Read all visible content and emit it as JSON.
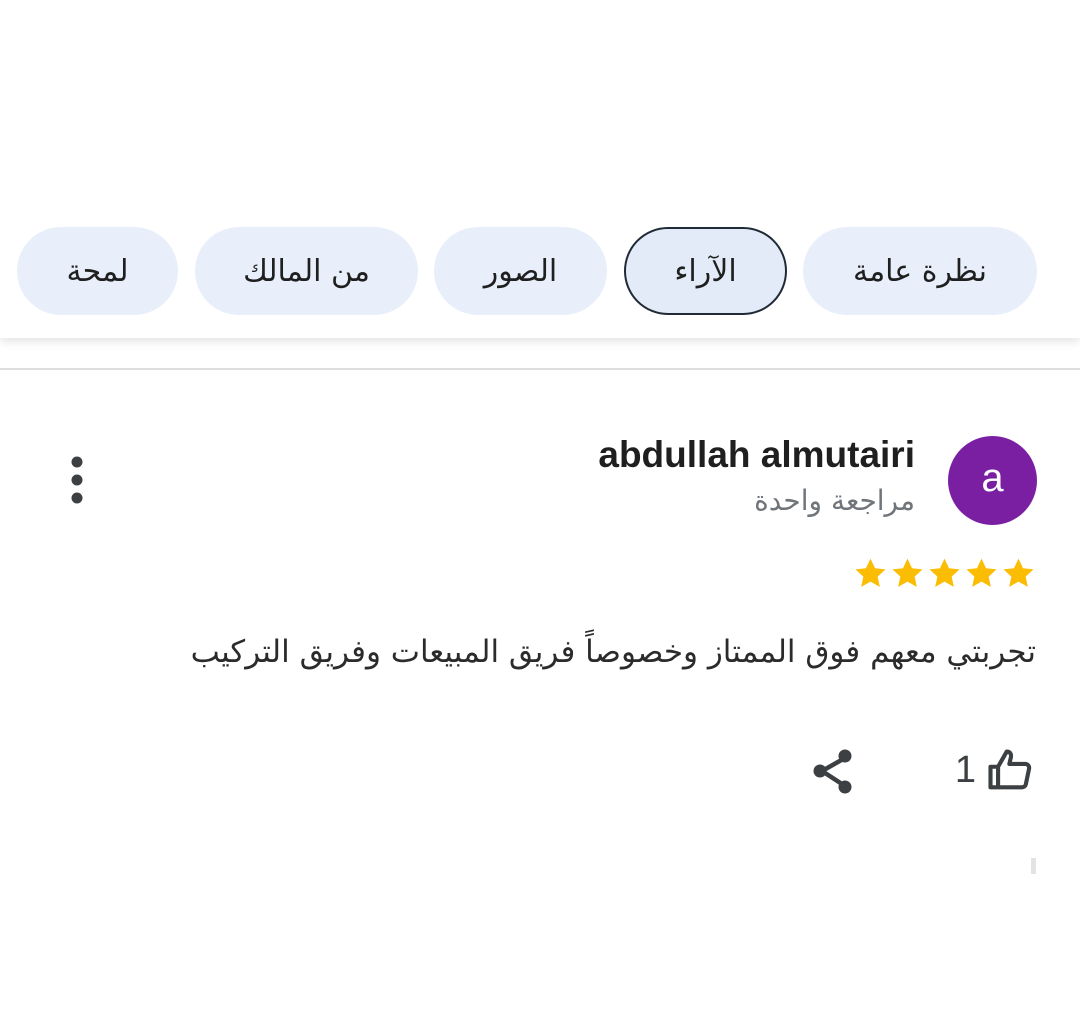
{
  "tabs": [
    {
      "label": "نظرة عامة",
      "selected": false
    },
    {
      "label": "الآراء",
      "selected": true
    },
    {
      "label": "الصور",
      "selected": false
    },
    {
      "label": "من المالك",
      "selected": false
    },
    {
      "label": "لمحة",
      "selected": false
    }
  ],
  "review": {
    "avatar_letter": "a",
    "avatar_color": "#7b1fa2",
    "author": "abdullah almutairi",
    "review_count": "مراجعة واحدة",
    "rating": 5,
    "text": "تجربتي معهم فوق الممتاز وخصوصاً فريق المبيعات وفريق التركيب",
    "likes": "1"
  },
  "icons": {
    "more": "more-vert-icon",
    "share": "share-icon",
    "like": "thumb-up-icon",
    "star": "star-icon"
  },
  "colors": {
    "chip_bg": "#e8effb",
    "star": "#fbbc04",
    "text": "#1f1f1f"
  }
}
